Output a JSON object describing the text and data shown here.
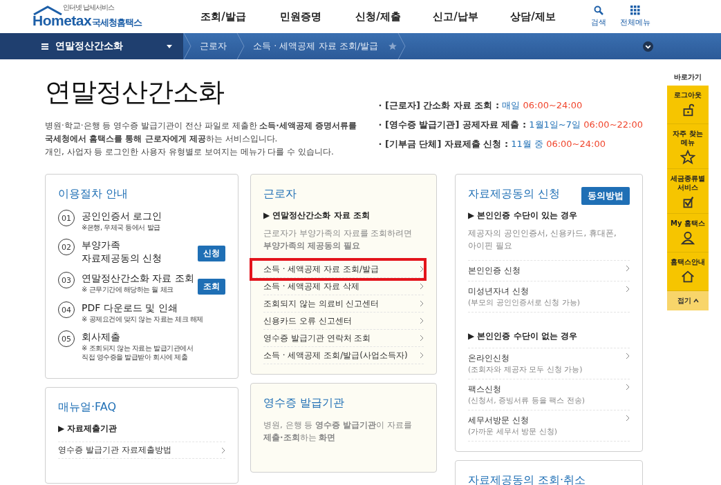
{
  "header": {
    "logo_tagline": "인터넷 납세서비스",
    "logo_word": "Hometax",
    "logo_name": "국세청홈택스",
    "menu": [
      "조회/발급",
      "민원증명",
      "신청/제출",
      "신고/납부",
      "상담/제보"
    ],
    "tools": [
      {
        "kind": "search",
        "label": "검색"
      },
      {
        "kind": "grid",
        "label": "전체메뉴"
      }
    ]
  },
  "nav": {
    "section": "연말정산간소화",
    "breadcrumb": [
      "근로자",
      "소득 · 세액공제 자료 조회/발급"
    ],
    "favorite": false
  },
  "page": {
    "title": "연말정산간소화",
    "intro": [
      "병원·학교·은행 등 영수증 발급기관이 전산 파일로 제출한 **소득·세액공제 증명서류를**",
      "**국세청에서 홈택스를 통해 근로자에게 제공**하는 서비스입니다.",
      "개인, 사업자 등 로그인한 사용자 유형별로 보여지는 메뉴가 다를 수 있습니다."
    ],
    "schedule": [
      {
        "label": "· [근로자] 간소화 자료 조회 :",
        "days": "매일",
        "time": "06:00~24:00"
      },
      {
        "label": "· [영수증 발급기관] 공제자료 제출 :",
        "days": "1월1일~7일",
        "time": "06:00~22:00"
      },
      {
        "label": "· [기부금 단체] 자료제출 신청 :",
        "days": "11월 중",
        "time": "06:00~24:00"
      }
    ]
  },
  "procedure": {
    "title": "이용절차 안내",
    "steps": [
      {
        "number": "01",
        "title": "공인인증서 로그인",
        "note": "※은행, 우체국 등에서 발급"
      },
      {
        "number": "02",
        "title": "부양가족\n자료제공동의 신청",
        "button": "신청"
      },
      {
        "number": "03",
        "title": "연말정산간소화 자료 조회",
        "note": "※ 근무기간에 해당하는 월 체크",
        "button": "조회"
      },
      {
        "number": "04",
        "title": "PDF 다운로드 및 인쇄",
        "note": "※ 공제요건에 맞지 않는 자료는 체크 해제"
      },
      {
        "number": "05",
        "title": "회사제출",
        "note": "※ 조회되지 않는 자료는 발급기관에서\n직접 영수증을 발급받아 회사에 제출"
      }
    ]
  },
  "manual": {
    "title": "매뉴얼·FAQ",
    "heading": "▶ 자료제출기관",
    "links": [
      "영수증 발급기관 자료제출방법"
    ]
  },
  "worker": {
    "title": "근로자",
    "heading": "▶ 연말정산간소화 자료 조회",
    "desc": "근로자가 부양가족의 자료를 조회하려면\n**부양가족의 제공동의 필요**",
    "links": [
      {
        "label": "소득 · 세액공제 자료 조회/발급",
        "highlighted": true
      },
      {
        "label": "소득 · 세액공제 자료 삭제",
        "highlighted": false
      },
      {
        "label": "조회되지 않는 의료비 신고센터",
        "highlighted": false
      },
      {
        "label": "신용카드 오류 신고센터",
        "highlighted": false
      },
      {
        "label": "영수증 발급기관 연락처 조회",
        "highlighted": false
      },
      {
        "label": "소득 · 세액공제 조회/발급(사업소득자)",
        "highlighted": false
      }
    ]
  },
  "issuer": {
    "title": "영수증 발급기관",
    "desc": "병원, 은행 등 **영수증 발급기관**이 자료를\n**제출·조회**하는 **화면**"
  },
  "consent": {
    "title": "자료제공동의 신청",
    "button": "동의방법",
    "groups": [
      {
        "heading": "▶ 본인인증 수단이 있는 경우",
        "desc": "제공자의 공인인증서, 신용카드, 휴대폰,\n아이핀 필요",
        "links": [
          {
            "label": "본인인증 신청"
          },
          {
            "label": "미성년자녀 신청",
            "sub": "(부모의 공인인증서로 신청 가능)"
          }
        ]
      },
      {
        "heading": "▶ 본인인증 수단이 없는 경우",
        "links": [
          {
            "label": "온라인신청",
            "sub": "(조회자와 제공자 모두 신청 가능)"
          },
          {
            "label": "팩스신청",
            "sub": "(신청서, 증빙서류 등을 팩스 전송)"
          },
          {
            "label": "세무서방문 신청",
            "sub": "(가까운 세무서 방문 신청)"
          }
        ]
      }
    ]
  },
  "consent_query": {
    "title": "자료제공동의 조회·취소"
  },
  "quick_menu": {
    "title": "바로가기",
    "items": [
      {
        "kind": "logout",
        "label": "로그아웃"
      },
      {
        "kind": "star",
        "label": "자주 찾는\n메뉴"
      },
      {
        "kind": "check",
        "label": "세금종류별\n서비스"
      },
      {
        "kind": "person",
        "label": "My 홈택스"
      },
      {
        "kind": "house",
        "label": "홈택스안내"
      }
    ],
    "collapse": "접기"
  }
}
